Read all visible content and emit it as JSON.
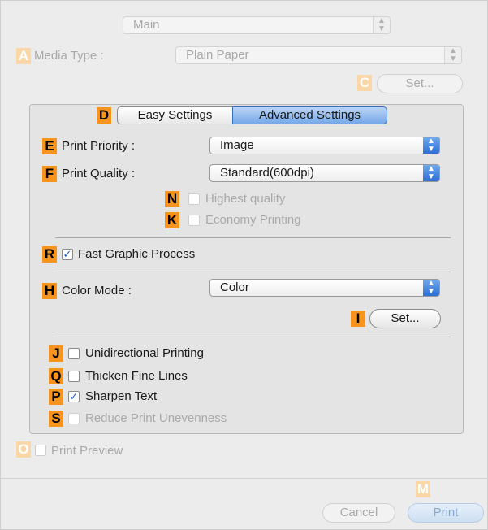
{
  "header": {
    "panel_select": {
      "value": "Main",
      "arrow_icon": "updown-arrows-icon"
    }
  },
  "media": {
    "badge_a": "A",
    "label": "Media Type :",
    "select_value": "Plain Paper",
    "badge_c": "C",
    "set_button": "Set..."
  },
  "tabs": {
    "badge_d": "D",
    "easy": "Easy Settings",
    "advanced": "Advanced Settings",
    "active": "advanced"
  },
  "print_priority": {
    "badge": "E",
    "label": "Print Priority :",
    "value": "Image"
  },
  "print_quality": {
    "badge": "F",
    "label": "Print Quality :",
    "value": "Standard(600dpi)"
  },
  "options_group1": [
    {
      "badge": "N",
      "label": "Highest quality",
      "checked": false,
      "enabled": false
    },
    {
      "badge": "K",
      "label": "Economy Printing",
      "checked": false,
      "enabled": false
    }
  ],
  "fast_graphic": {
    "badge": "R",
    "label": "Fast Graphic Process",
    "checked": true,
    "enabled": true
  },
  "color_mode": {
    "badge": "H",
    "label": "Color Mode :",
    "value": "Color",
    "badge_i": "I",
    "set_button": "Set..."
  },
  "options_group2": [
    {
      "badge": "J",
      "label": "Unidirectional Printing",
      "checked": false,
      "enabled": true
    },
    {
      "badge": "Q",
      "label": "Thicken Fine Lines",
      "checked": false,
      "enabled": true
    },
    {
      "badge": "P",
      "label": "Sharpen Text",
      "checked": true,
      "enabled": true
    },
    {
      "badge": "S",
      "label": "Reduce Print Unevenness",
      "checked": false,
      "enabled": false
    }
  ],
  "print_preview": {
    "badge": "O",
    "label": "Print Preview",
    "checked": false,
    "enabled": false
  },
  "footer": {
    "badge_m": "M",
    "cancel": "Cancel",
    "print": "Print"
  },
  "colors": {
    "badge_orange": "#f7941d",
    "badge_faded": "#fbd6a6",
    "accent_blue": "#2c6fd4",
    "check_blue": "#1a5fc8"
  }
}
